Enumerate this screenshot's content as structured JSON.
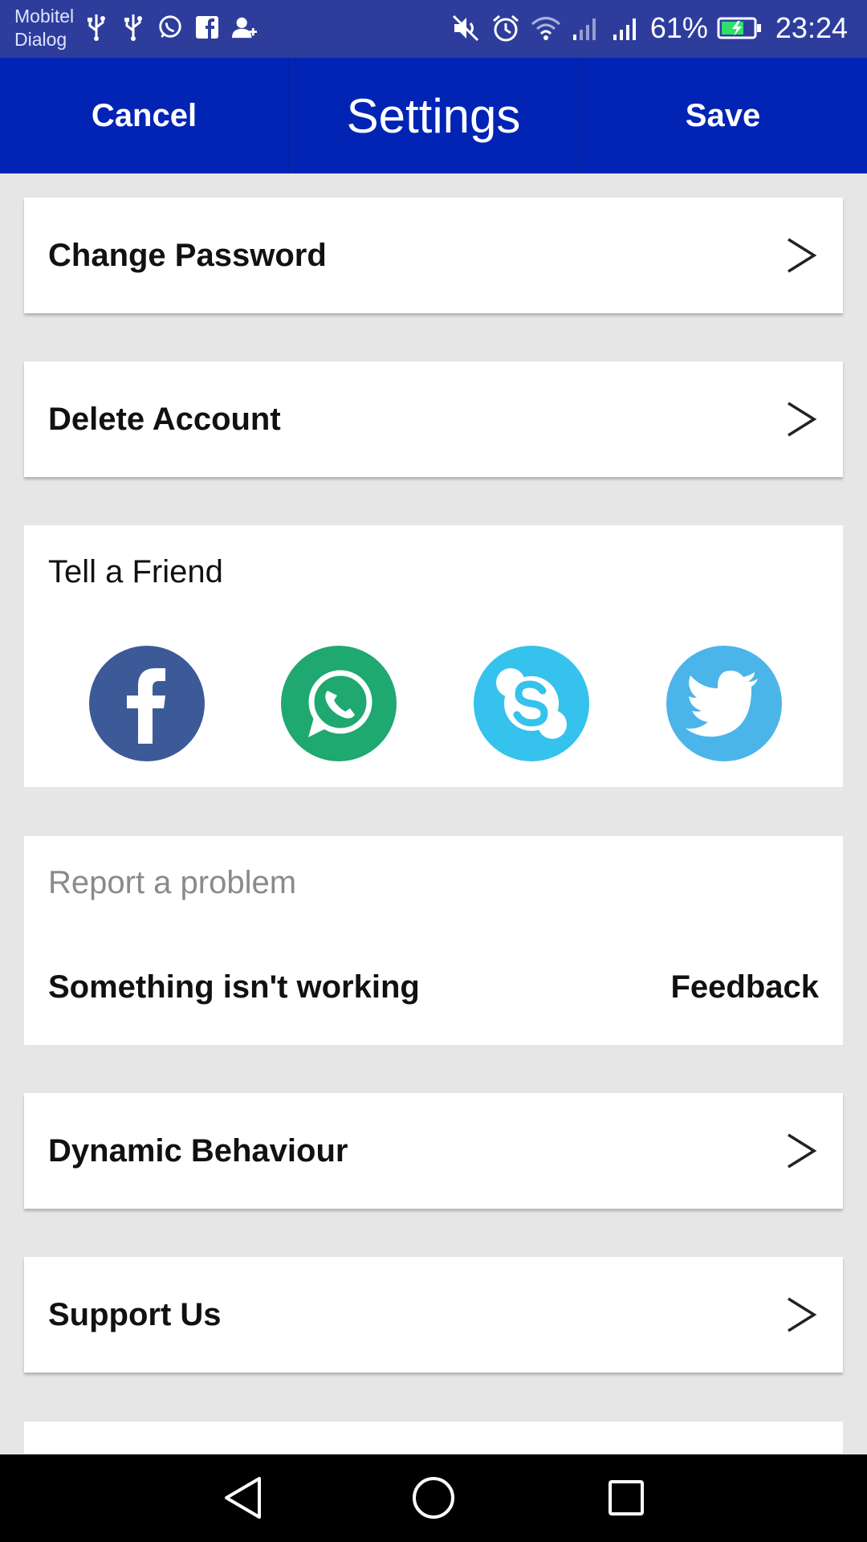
{
  "status_bar": {
    "carrier_1": "Mobitel",
    "carrier_2": "Dialog",
    "left_icons": [
      "usb-icon",
      "usb-icon",
      "whatsapp-icon",
      "facebook-icon",
      "add-person-icon"
    ],
    "right_icons": [
      "mute-icon",
      "alarm-icon",
      "wifi-icon",
      "signal-icon",
      "signal-icon"
    ],
    "battery_percent": "61%",
    "time": "23:24"
  },
  "app_bar": {
    "cancel_label": "Cancel",
    "title": "Settings",
    "save_label": "Save",
    "color": "#0224b4"
  },
  "settings": {
    "change_password": "Change Password",
    "delete_account": "Delete Account",
    "tell_a_friend": {
      "title": "Tell a Friend",
      "networks": [
        {
          "name": "facebook-icon",
          "color": "#3d5a98"
        },
        {
          "name": "whatsapp-icon",
          "color": "#1fa870"
        },
        {
          "name": "skype-icon",
          "color": "#35c2ec"
        },
        {
          "name": "twitter-icon",
          "color": "#4bb5ea"
        }
      ]
    },
    "report_problem": {
      "title": "Report a problem",
      "something_not_working": "Something isn't working",
      "feedback": "Feedback"
    },
    "dynamic_behaviour": "Dynamic Behaviour",
    "support_us": "Support Us"
  },
  "nav_bar": {
    "icons": [
      "back-icon",
      "home-icon",
      "recents-icon"
    ]
  }
}
